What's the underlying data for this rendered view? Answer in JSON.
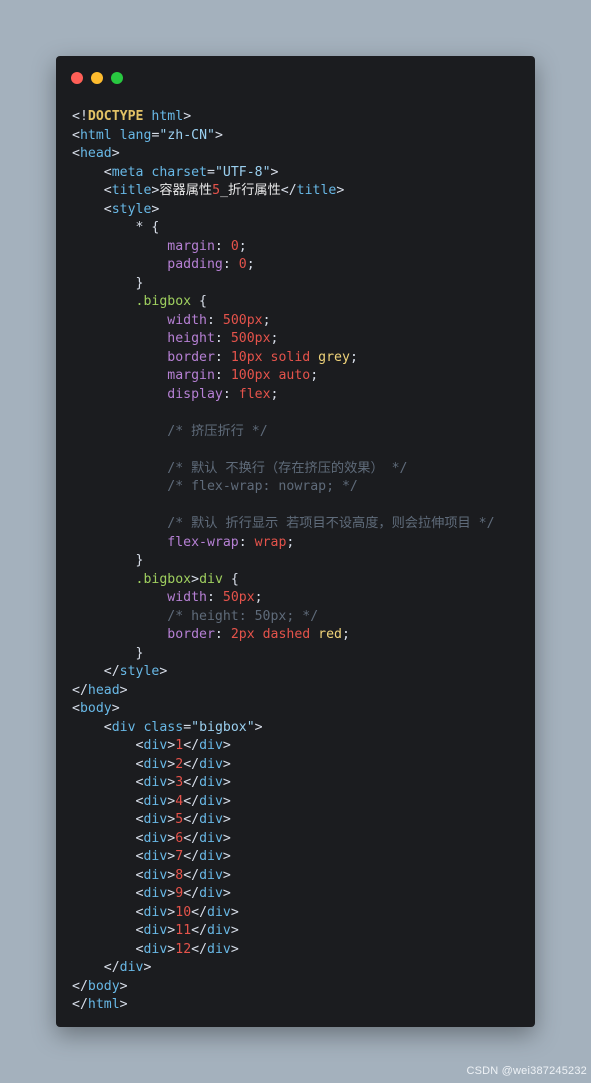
{
  "window": {
    "controls": [
      {
        "name": "close",
        "color": "#ff5f57"
      },
      {
        "name": "minimize",
        "color": "#febc2e"
      },
      {
        "name": "maximize",
        "color": "#28c840"
      }
    ]
  },
  "watermark": "CSDN @wei387245232",
  "code_lines": [
    [
      {
        "t": "<!",
        "c": "punc"
      },
      {
        "t": "DOCTYPE",
        "c": "doctype"
      },
      {
        "t": " ",
        "c": "punc"
      },
      {
        "t": "html",
        "c": "tag"
      },
      {
        "t": ">",
        "c": "punc"
      }
    ],
    [
      {
        "t": "<",
        "c": "punc"
      },
      {
        "t": "html",
        "c": "tag"
      },
      {
        "t": " ",
        "c": "punc"
      },
      {
        "t": "lang",
        "c": "attr"
      },
      {
        "t": "=",
        "c": "punc"
      },
      {
        "t": "\"zh-CN\"",
        "c": "str"
      },
      {
        "t": ">",
        "c": "punc"
      }
    ],
    [
      {
        "t": "<",
        "c": "punc"
      },
      {
        "t": "head",
        "c": "tag"
      },
      {
        "t": ">",
        "c": "punc"
      }
    ],
    [
      {
        "t": "    <",
        "c": "punc"
      },
      {
        "t": "meta",
        "c": "tag"
      },
      {
        "t": " ",
        "c": "punc"
      },
      {
        "t": "charset",
        "c": "attr"
      },
      {
        "t": "=",
        "c": "punc"
      },
      {
        "t": "\"UTF-8\"",
        "c": "str"
      },
      {
        "t": ">",
        "c": "punc"
      }
    ],
    [
      {
        "t": "    <",
        "c": "punc"
      },
      {
        "t": "title",
        "c": "tag"
      },
      {
        "t": ">",
        "c": "punc"
      },
      {
        "t": "容器属性",
        "c": "text"
      },
      {
        "t": "5",
        "c": "num"
      },
      {
        "t": "_折行属性",
        "c": "text"
      },
      {
        "t": "</",
        "c": "punc"
      },
      {
        "t": "title",
        "c": "tag"
      },
      {
        "t": ">",
        "c": "punc"
      }
    ],
    [
      {
        "t": "    <",
        "c": "punc"
      },
      {
        "t": "style",
        "c": "tag"
      },
      {
        "t": ">",
        "c": "punc"
      }
    ],
    [
      {
        "t": "        * {",
        "c": "punc"
      }
    ],
    [
      {
        "t": "            ",
        "c": "punc"
      },
      {
        "t": "margin",
        "c": "prop"
      },
      {
        "t": ": ",
        "c": "punc"
      },
      {
        "t": "0",
        "c": "val"
      },
      {
        "t": ";",
        "c": "punc"
      }
    ],
    [
      {
        "t": "            ",
        "c": "punc"
      },
      {
        "t": "padding",
        "c": "prop"
      },
      {
        "t": ": ",
        "c": "punc"
      },
      {
        "t": "0",
        "c": "val"
      },
      {
        "t": ";",
        "c": "punc"
      }
    ],
    [
      {
        "t": "        }",
        "c": "punc"
      }
    ],
    [
      {
        "t": "        ",
        "c": "punc"
      },
      {
        "t": ".bigbox",
        "c": "selector"
      },
      {
        "t": " {",
        "c": "punc"
      }
    ],
    [
      {
        "t": "            ",
        "c": "punc"
      },
      {
        "t": "width",
        "c": "prop"
      },
      {
        "t": ": ",
        "c": "punc"
      },
      {
        "t": "500px",
        "c": "val"
      },
      {
        "t": ";",
        "c": "punc"
      }
    ],
    [
      {
        "t": "            ",
        "c": "punc"
      },
      {
        "t": "height",
        "c": "prop"
      },
      {
        "t": ": ",
        "c": "punc"
      },
      {
        "t": "500px",
        "c": "val"
      },
      {
        "t": ";",
        "c": "punc"
      }
    ],
    [
      {
        "t": "            ",
        "c": "punc"
      },
      {
        "t": "border",
        "c": "prop"
      },
      {
        "t": ": ",
        "c": "punc"
      },
      {
        "t": "10px solid",
        "c": "val"
      },
      {
        "t": " ",
        "c": "punc"
      },
      {
        "t": "grey",
        "c": "kw"
      },
      {
        "t": ";",
        "c": "punc"
      }
    ],
    [
      {
        "t": "            ",
        "c": "punc"
      },
      {
        "t": "margin",
        "c": "prop"
      },
      {
        "t": ": ",
        "c": "punc"
      },
      {
        "t": "100px auto",
        "c": "val"
      },
      {
        "t": ";",
        "c": "punc"
      }
    ],
    [
      {
        "t": "            ",
        "c": "punc"
      },
      {
        "t": "display",
        "c": "prop"
      },
      {
        "t": ": ",
        "c": "punc"
      },
      {
        "t": "flex",
        "c": "val"
      },
      {
        "t": ";",
        "c": "punc"
      }
    ],
    [
      {
        "t": "",
        "c": "punc"
      }
    ],
    [
      {
        "t": "            ",
        "c": "punc"
      },
      {
        "t": "/* 挤压折行 */",
        "c": "comment"
      }
    ],
    [
      {
        "t": "",
        "c": "punc"
      }
    ],
    [
      {
        "t": "            ",
        "c": "punc"
      },
      {
        "t": "/* 默认 不换行（存在挤压的效果） */",
        "c": "comment"
      }
    ],
    [
      {
        "t": "            ",
        "c": "punc"
      },
      {
        "t": "/* flex-wrap: nowrap; */",
        "c": "comment"
      }
    ],
    [
      {
        "t": "",
        "c": "punc"
      }
    ],
    [
      {
        "t": "            ",
        "c": "punc"
      },
      {
        "t": "/* 默认 折行显示 若项目不设高度，则会拉伸项目 */",
        "c": "comment"
      }
    ],
    [
      {
        "t": "            ",
        "c": "punc"
      },
      {
        "t": "flex-wrap",
        "c": "prop"
      },
      {
        "t": ": ",
        "c": "punc"
      },
      {
        "t": "wrap",
        "c": "val"
      },
      {
        "t": ";",
        "c": "punc"
      }
    ],
    [
      {
        "t": "        }",
        "c": "punc"
      }
    ],
    [
      {
        "t": "        ",
        "c": "punc"
      },
      {
        "t": ".bigbox",
        "c": "selector"
      },
      {
        "t": ">",
        "c": "punc"
      },
      {
        "t": "div",
        "c": "selector"
      },
      {
        "t": " {",
        "c": "punc"
      }
    ],
    [
      {
        "t": "            ",
        "c": "punc"
      },
      {
        "t": "width",
        "c": "prop"
      },
      {
        "t": ": ",
        "c": "punc"
      },
      {
        "t": "50px",
        "c": "val"
      },
      {
        "t": ";",
        "c": "punc"
      }
    ],
    [
      {
        "t": "            ",
        "c": "punc"
      },
      {
        "t": "/* height: 50px; */",
        "c": "comment"
      }
    ],
    [
      {
        "t": "            ",
        "c": "punc"
      },
      {
        "t": "border",
        "c": "prop"
      },
      {
        "t": ": ",
        "c": "punc"
      },
      {
        "t": "2px dashed",
        "c": "val"
      },
      {
        "t": " ",
        "c": "punc"
      },
      {
        "t": "red",
        "c": "kw"
      },
      {
        "t": ";",
        "c": "punc"
      }
    ],
    [
      {
        "t": "        }",
        "c": "punc"
      }
    ],
    [
      {
        "t": "    </",
        "c": "punc"
      },
      {
        "t": "style",
        "c": "tag"
      },
      {
        "t": ">",
        "c": "punc"
      }
    ],
    [
      {
        "t": "</",
        "c": "punc"
      },
      {
        "t": "head",
        "c": "tag"
      },
      {
        "t": ">",
        "c": "punc"
      }
    ],
    [
      {
        "t": "<",
        "c": "punc"
      },
      {
        "t": "body",
        "c": "tag"
      },
      {
        "t": ">",
        "c": "punc"
      }
    ],
    [
      {
        "t": "    <",
        "c": "punc"
      },
      {
        "t": "div",
        "c": "tag"
      },
      {
        "t": " ",
        "c": "punc"
      },
      {
        "t": "class",
        "c": "attr"
      },
      {
        "t": "=",
        "c": "punc"
      },
      {
        "t": "\"bigbox\"",
        "c": "str"
      },
      {
        "t": ">",
        "c": "punc"
      }
    ],
    [
      {
        "t": "        <",
        "c": "punc"
      },
      {
        "t": "div",
        "c": "tag"
      },
      {
        "t": ">",
        "c": "punc"
      },
      {
        "t": "1",
        "c": "num"
      },
      {
        "t": "</",
        "c": "punc"
      },
      {
        "t": "div",
        "c": "tag"
      },
      {
        "t": ">",
        "c": "punc"
      }
    ],
    [
      {
        "t": "        <",
        "c": "punc"
      },
      {
        "t": "div",
        "c": "tag"
      },
      {
        "t": ">",
        "c": "punc"
      },
      {
        "t": "2",
        "c": "num"
      },
      {
        "t": "</",
        "c": "punc"
      },
      {
        "t": "div",
        "c": "tag"
      },
      {
        "t": ">",
        "c": "punc"
      }
    ],
    [
      {
        "t": "        <",
        "c": "punc"
      },
      {
        "t": "div",
        "c": "tag"
      },
      {
        "t": ">",
        "c": "punc"
      },
      {
        "t": "3",
        "c": "num"
      },
      {
        "t": "</",
        "c": "punc"
      },
      {
        "t": "div",
        "c": "tag"
      },
      {
        "t": ">",
        "c": "punc"
      }
    ],
    [
      {
        "t": "        <",
        "c": "punc"
      },
      {
        "t": "div",
        "c": "tag"
      },
      {
        "t": ">",
        "c": "punc"
      },
      {
        "t": "4",
        "c": "num"
      },
      {
        "t": "</",
        "c": "punc"
      },
      {
        "t": "div",
        "c": "tag"
      },
      {
        "t": ">",
        "c": "punc"
      }
    ],
    [
      {
        "t": "        <",
        "c": "punc"
      },
      {
        "t": "div",
        "c": "tag"
      },
      {
        "t": ">",
        "c": "punc"
      },
      {
        "t": "5",
        "c": "num"
      },
      {
        "t": "</",
        "c": "punc"
      },
      {
        "t": "div",
        "c": "tag"
      },
      {
        "t": ">",
        "c": "punc"
      }
    ],
    [
      {
        "t": "        <",
        "c": "punc"
      },
      {
        "t": "div",
        "c": "tag"
      },
      {
        "t": ">",
        "c": "punc"
      },
      {
        "t": "6",
        "c": "num"
      },
      {
        "t": "</",
        "c": "punc"
      },
      {
        "t": "div",
        "c": "tag"
      },
      {
        "t": ">",
        "c": "punc"
      }
    ],
    [
      {
        "t": "        <",
        "c": "punc"
      },
      {
        "t": "div",
        "c": "tag"
      },
      {
        "t": ">",
        "c": "punc"
      },
      {
        "t": "7",
        "c": "num"
      },
      {
        "t": "</",
        "c": "punc"
      },
      {
        "t": "div",
        "c": "tag"
      },
      {
        "t": ">",
        "c": "punc"
      }
    ],
    [
      {
        "t": "        <",
        "c": "punc"
      },
      {
        "t": "div",
        "c": "tag"
      },
      {
        "t": ">",
        "c": "punc"
      },
      {
        "t": "8",
        "c": "num"
      },
      {
        "t": "</",
        "c": "punc"
      },
      {
        "t": "div",
        "c": "tag"
      },
      {
        "t": ">",
        "c": "punc"
      }
    ],
    [
      {
        "t": "        <",
        "c": "punc"
      },
      {
        "t": "div",
        "c": "tag"
      },
      {
        "t": ">",
        "c": "punc"
      },
      {
        "t": "9",
        "c": "num"
      },
      {
        "t": "</",
        "c": "punc"
      },
      {
        "t": "div",
        "c": "tag"
      },
      {
        "t": ">",
        "c": "punc"
      }
    ],
    [
      {
        "t": "        <",
        "c": "punc"
      },
      {
        "t": "div",
        "c": "tag"
      },
      {
        "t": ">",
        "c": "punc"
      },
      {
        "t": "10",
        "c": "num"
      },
      {
        "t": "</",
        "c": "punc"
      },
      {
        "t": "div",
        "c": "tag"
      },
      {
        "t": ">",
        "c": "punc"
      }
    ],
    [
      {
        "t": "        <",
        "c": "punc"
      },
      {
        "t": "div",
        "c": "tag"
      },
      {
        "t": ">",
        "c": "punc"
      },
      {
        "t": "11",
        "c": "num"
      },
      {
        "t": "</",
        "c": "punc"
      },
      {
        "t": "div",
        "c": "tag"
      },
      {
        "t": ">",
        "c": "punc"
      }
    ],
    [
      {
        "t": "        <",
        "c": "punc"
      },
      {
        "t": "div",
        "c": "tag"
      },
      {
        "t": ">",
        "c": "punc"
      },
      {
        "t": "12",
        "c": "num"
      },
      {
        "t": "</",
        "c": "punc"
      },
      {
        "t": "div",
        "c": "tag"
      },
      {
        "t": ">",
        "c": "punc"
      }
    ],
    [
      {
        "t": "    </",
        "c": "punc"
      },
      {
        "t": "div",
        "c": "tag"
      },
      {
        "t": ">",
        "c": "punc"
      }
    ],
    [
      {
        "t": "</",
        "c": "punc"
      },
      {
        "t": "body",
        "c": "tag"
      },
      {
        "t": ">",
        "c": "punc"
      }
    ],
    [
      {
        "t": "</",
        "c": "punc"
      },
      {
        "t": "html",
        "c": "tag"
      },
      {
        "t": ">",
        "c": "punc"
      }
    ]
  ]
}
